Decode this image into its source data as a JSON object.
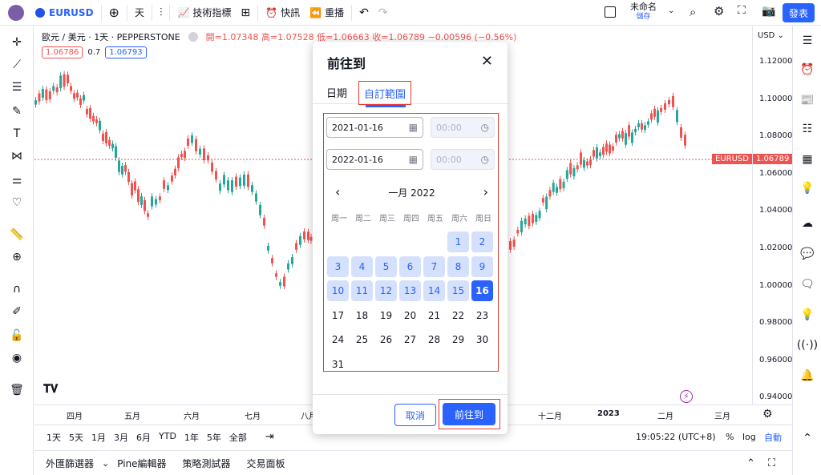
{
  "topbar": {
    "symbol": "EURUSD",
    "interval": "天",
    "indicators": "技術指標",
    "alert": "快訊",
    "replay": "重播",
    "layout_name": "未命名",
    "layout_sub": "儲存",
    "publish": "發表"
  },
  "legend": {
    "title": "歐元 / 美元 · 1天 · PEPPERSTONE",
    "ohlc": "開=1.07348 高=1.07528 低=1.06663 收=1.06789 −0.00596 (−0.56%)",
    "bid": "1.06786",
    "spread": "0.7",
    "ask": "1.06793"
  },
  "price_axis": {
    "currency": "USD",
    "ticks": [
      "1.12000",
      "1.10000",
      "1.08000",
      "1.06000",
      "1.04000",
      "1.02000",
      "1.00000",
      "0.98000",
      "0.96000",
      "0.94000"
    ],
    "current_symbol": "EURUSD",
    "current_price": "1.06789"
  },
  "time_axis": {
    "ticks": [
      "四月",
      "五月",
      "六月",
      "七月",
      "八月",
      "十二月",
      "2023",
      "二月",
      "三月"
    ]
  },
  "bottombar": {
    "ranges": [
      "1天",
      "5天",
      "1月",
      "3月",
      "6月",
      "YTD",
      "1年",
      "5年",
      "全部"
    ],
    "clock": "19:05:22 (UTC+8)",
    "percent": "%",
    "log": "log",
    "auto": "自動"
  },
  "panelbar": {
    "tabs": [
      "外匯篩選器",
      "Pine編輯器",
      "策略測試器",
      "交易面板"
    ]
  },
  "modal": {
    "title": "前往到",
    "tab_date": "日期",
    "tab_custom": "自訂範圍",
    "start_date": "2021-01-16",
    "start_time": "00:00",
    "end_date": "2022-01-16",
    "end_time": "00:00",
    "month_label": "一月 2022",
    "weekdays": [
      "周一",
      "周二",
      "周三",
      "周四",
      "周五",
      "周六",
      "周日"
    ],
    "days": [
      "1",
      "2",
      "3",
      "4",
      "5",
      "6",
      "7",
      "8",
      "9",
      "10",
      "11",
      "12",
      "13",
      "14",
      "15",
      "16",
      "17",
      "18",
      "19",
      "20",
      "21",
      "22",
      "23",
      "24",
      "25",
      "26",
      "27",
      "28",
      "29",
      "30",
      "31"
    ],
    "selected_day": "16",
    "cancel": "取消",
    "go": "前往到"
  },
  "colors": {
    "accent": "#2962ff",
    "down": "#ef5350",
    "up": "#26a69a",
    "highlight": "#e53935"
  }
}
